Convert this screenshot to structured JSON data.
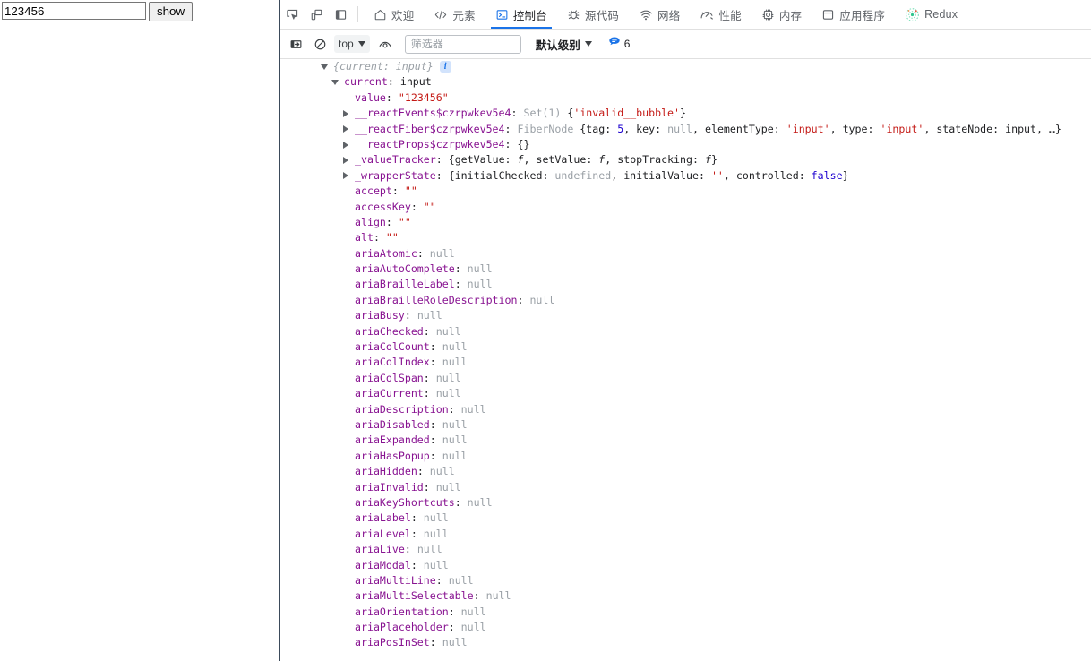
{
  "page": {
    "input_value": "123456",
    "input_placeholder": "",
    "show_button_label": "show"
  },
  "devtools": {
    "toolbar_icons": [
      {
        "name": "inspect-element-icon"
      },
      {
        "name": "device-toolbar-icon"
      },
      {
        "name": "dock-side-icon"
      }
    ],
    "tabs": [
      {
        "label": "欢迎",
        "icon": "home-icon",
        "active": false
      },
      {
        "label": "元素",
        "icon": "code-brackets-icon",
        "active": false
      },
      {
        "label": "控制台",
        "icon": "console-terminal-icon",
        "active": true
      },
      {
        "label": "源代码",
        "icon": "bug-sources-icon",
        "active": false
      },
      {
        "label": "网络",
        "icon": "wifi-network-icon",
        "active": false
      },
      {
        "label": "性能",
        "icon": "gauge-performance-icon",
        "active": false
      },
      {
        "label": "内存",
        "icon": "chip-memory-icon",
        "active": false
      },
      {
        "label": "应用程序",
        "icon": "application-panel-icon",
        "active": false
      },
      {
        "label": "Redux",
        "icon": "redux-atom-icon",
        "active": false
      }
    ],
    "filterbar": {
      "clear_console_icon": "clear-console-icon",
      "no_entry_icon": "no-entry-icon",
      "context_value": "top",
      "eye_icon": "live-expression-eye-icon",
      "filter_placeholder": "筛选器",
      "filter_value": "",
      "level_label": "默认级别",
      "message_icon": "message-bubble-icon",
      "message_count": "6"
    },
    "accent_color": "#1a73e8",
    "console_rows": [
      {
        "indent": 0,
        "arrow": "open",
        "parts": [
          {
            "t": "{current: input}",
            "c": "k-preview"
          },
          {
            "t": " ",
            "c": "punct"
          },
          {
            "t": "i",
            "c": "info-badge"
          }
        ]
      },
      {
        "indent": 1,
        "arrow": "open",
        "parts": [
          {
            "t": "current",
            "c": "k-prop"
          },
          {
            "t": ": ",
            "c": "punct"
          },
          {
            "t": "input",
            "c": "v-plain"
          }
        ]
      },
      {
        "indent": 2,
        "arrow": "none",
        "parts": [
          {
            "t": "value",
            "c": "k-prop"
          },
          {
            "t": ": ",
            "c": "punct"
          },
          {
            "t": "\"123456\"",
            "c": "v-str"
          }
        ]
      },
      {
        "indent": 2,
        "arrow": "closed",
        "parts": [
          {
            "t": "__reactEvents$czrpwkev5e4",
            "c": "k-prop"
          },
          {
            "t": ": ",
            "c": "punct"
          },
          {
            "t": "Set(1)",
            "c": "v-dim"
          },
          {
            "t": " {",
            "c": "punct"
          },
          {
            "t": "'invalid__bubble'",
            "c": "v-str"
          },
          {
            "t": "}",
            "c": "punct"
          }
        ]
      },
      {
        "indent": 2,
        "arrow": "closed",
        "parts": [
          {
            "t": "__reactFiber$czrpwkev5e4",
            "c": "k-prop"
          },
          {
            "t": ": ",
            "c": "punct"
          },
          {
            "t": "FiberNode",
            "c": "v-dim"
          },
          {
            "t": " {",
            "c": "punct"
          },
          {
            "t": "tag",
            "c": "v-plain"
          },
          {
            "t": ": ",
            "c": "punct"
          },
          {
            "t": "5",
            "c": "v-num"
          },
          {
            "t": ", ",
            "c": "punct"
          },
          {
            "t": "key",
            "c": "v-plain"
          },
          {
            "t": ": ",
            "c": "punct"
          },
          {
            "t": "null",
            "c": "v-null"
          },
          {
            "t": ", ",
            "c": "punct"
          },
          {
            "t": "elementType",
            "c": "v-plain"
          },
          {
            "t": ": ",
            "c": "punct"
          },
          {
            "t": "'input'",
            "c": "v-str"
          },
          {
            "t": ", ",
            "c": "punct"
          },
          {
            "t": "type",
            "c": "v-plain"
          },
          {
            "t": ": ",
            "c": "punct"
          },
          {
            "t": "'input'",
            "c": "v-str"
          },
          {
            "t": ", ",
            "c": "punct"
          },
          {
            "t": "stateNode",
            "c": "v-plain"
          },
          {
            "t": ": ",
            "c": "punct"
          },
          {
            "t": "input",
            "c": "v-plain"
          },
          {
            "t": ", …}",
            "c": "punct"
          }
        ]
      },
      {
        "indent": 2,
        "arrow": "closed",
        "parts": [
          {
            "t": "__reactProps$czrpwkev5e4",
            "c": "k-prop"
          },
          {
            "t": ": ",
            "c": "punct"
          },
          {
            "t": "{}",
            "c": "punct"
          }
        ]
      },
      {
        "indent": 2,
        "arrow": "closed",
        "parts": [
          {
            "t": "_valueTracker",
            "c": "k-prop"
          },
          {
            "t": ": ",
            "c": "punct"
          },
          {
            "t": "{",
            "c": "punct"
          },
          {
            "t": "getValue",
            "c": "v-plain"
          },
          {
            "t": ": ",
            "c": "punct"
          },
          {
            "t": "f",
            "c": "v-fn"
          },
          {
            "t": ", ",
            "c": "punct"
          },
          {
            "t": "setValue",
            "c": "v-plain"
          },
          {
            "t": ": ",
            "c": "punct"
          },
          {
            "t": "f",
            "c": "v-fn"
          },
          {
            "t": ", ",
            "c": "punct"
          },
          {
            "t": "stopTracking",
            "c": "v-plain"
          },
          {
            "t": ": ",
            "c": "punct"
          },
          {
            "t": "f",
            "c": "v-fn"
          },
          {
            "t": "}",
            "c": "punct"
          }
        ]
      },
      {
        "indent": 2,
        "arrow": "closed",
        "parts": [
          {
            "t": "_wrapperState",
            "c": "k-prop"
          },
          {
            "t": ": ",
            "c": "punct"
          },
          {
            "t": "{",
            "c": "punct"
          },
          {
            "t": "initialChecked",
            "c": "v-plain"
          },
          {
            "t": ": ",
            "c": "punct"
          },
          {
            "t": "undefined",
            "c": "v-undef"
          },
          {
            "t": ", ",
            "c": "punct"
          },
          {
            "t": "initialValue",
            "c": "v-plain"
          },
          {
            "t": ": ",
            "c": "punct"
          },
          {
            "t": "''",
            "c": "v-str"
          },
          {
            "t": ", ",
            "c": "punct"
          },
          {
            "t": "controlled",
            "c": "v-plain"
          },
          {
            "t": ": ",
            "c": "punct"
          },
          {
            "t": "false",
            "c": "v-bool"
          },
          {
            "t": "}",
            "c": "punct"
          }
        ]
      },
      {
        "indent": 2,
        "arrow": "none",
        "parts": [
          {
            "t": "accept",
            "c": "k-prop"
          },
          {
            "t": ": ",
            "c": "punct"
          },
          {
            "t": "\"\"",
            "c": "v-str"
          }
        ]
      },
      {
        "indent": 2,
        "arrow": "none",
        "parts": [
          {
            "t": "accessKey",
            "c": "k-prop"
          },
          {
            "t": ": ",
            "c": "punct"
          },
          {
            "t": "\"\"",
            "c": "v-str"
          }
        ]
      },
      {
        "indent": 2,
        "arrow": "none",
        "parts": [
          {
            "t": "align",
            "c": "k-prop"
          },
          {
            "t": ": ",
            "c": "punct"
          },
          {
            "t": "\"\"",
            "c": "v-str"
          }
        ]
      },
      {
        "indent": 2,
        "arrow": "none",
        "parts": [
          {
            "t": "alt",
            "c": "k-prop"
          },
          {
            "t": ": ",
            "c": "punct"
          },
          {
            "t": "\"\"",
            "c": "v-str"
          }
        ]
      },
      {
        "indent": 2,
        "arrow": "none",
        "parts": [
          {
            "t": "ariaAtomic",
            "c": "k-prop"
          },
          {
            "t": ": ",
            "c": "punct"
          },
          {
            "t": "null",
            "c": "v-null"
          }
        ]
      },
      {
        "indent": 2,
        "arrow": "none",
        "parts": [
          {
            "t": "ariaAutoComplete",
            "c": "k-prop"
          },
          {
            "t": ": ",
            "c": "punct"
          },
          {
            "t": "null",
            "c": "v-null"
          }
        ]
      },
      {
        "indent": 2,
        "arrow": "none",
        "parts": [
          {
            "t": "ariaBrailleLabel",
            "c": "k-prop"
          },
          {
            "t": ": ",
            "c": "punct"
          },
          {
            "t": "null",
            "c": "v-null"
          }
        ]
      },
      {
        "indent": 2,
        "arrow": "none",
        "parts": [
          {
            "t": "ariaBrailleRoleDescription",
            "c": "k-prop"
          },
          {
            "t": ": ",
            "c": "punct"
          },
          {
            "t": "null",
            "c": "v-null"
          }
        ]
      },
      {
        "indent": 2,
        "arrow": "none",
        "parts": [
          {
            "t": "ariaBusy",
            "c": "k-prop"
          },
          {
            "t": ": ",
            "c": "punct"
          },
          {
            "t": "null",
            "c": "v-null"
          }
        ]
      },
      {
        "indent": 2,
        "arrow": "none",
        "parts": [
          {
            "t": "ariaChecked",
            "c": "k-prop"
          },
          {
            "t": ": ",
            "c": "punct"
          },
          {
            "t": "null",
            "c": "v-null"
          }
        ]
      },
      {
        "indent": 2,
        "arrow": "none",
        "parts": [
          {
            "t": "ariaColCount",
            "c": "k-prop"
          },
          {
            "t": ": ",
            "c": "punct"
          },
          {
            "t": "null",
            "c": "v-null"
          }
        ]
      },
      {
        "indent": 2,
        "arrow": "none",
        "parts": [
          {
            "t": "ariaColIndex",
            "c": "k-prop"
          },
          {
            "t": ": ",
            "c": "punct"
          },
          {
            "t": "null",
            "c": "v-null"
          }
        ]
      },
      {
        "indent": 2,
        "arrow": "none",
        "parts": [
          {
            "t": "ariaColSpan",
            "c": "k-prop"
          },
          {
            "t": ": ",
            "c": "punct"
          },
          {
            "t": "null",
            "c": "v-null"
          }
        ]
      },
      {
        "indent": 2,
        "arrow": "none",
        "parts": [
          {
            "t": "ariaCurrent",
            "c": "k-prop"
          },
          {
            "t": ": ",
            "c": "punct"
          },
          {
            "t": "null",
            "c": "v-null"
          }
        ]
      },
      {
        "indent": 2,
        "arrow": "none",
        "parts": [
          {
            "t": "ariaDescription",
            "c": "k-prop"
          },
          {
            "t": ": ",
            "c": "punct"
          },
          {
            "t": "null",
            "c": "v-null"
          }
        ]
      },
      {
        "indent": 2,
        "arrow": "none",
        "parts": [
          {
            "t": "ariaDisabled",
            "c": "k-prop"
          },
          {
            "t": ": ",
            "c": "punct"
          },
          {
            "t": "null",
            "c": "v-null"
          }
        ]
      },
      {
        "indent": 2,
        "arrow": "none",
        "parts": [
          {
            "t": "ariaExpanded",
            "c": "k-prop"
          },
          {
            "t": ": ",
            "c": "punct"
          },
          {
            "t": "null",
            "c": "v-null"
          }
        ]
      },
      {
        "indent": 2,
        "arrow": "none",
        "parts": [
          {
            "t": "ariaHasPopup",
            "c": "k-prop"
          },
          {
            "t": ": ",
            "c": "punct"
          },
          {
            "t": "null",
            "c": "v-null"
          }
        ]
      },
      {
        "indent": 2,
        "arrow": "none",
        "parts": [
          {
            "t": "ariaHidden",
            "c": "k-prop"
          },
          {
            "t": ": ",
            "c": "punct"
          },
          {
            "t": "null",
            "c": "v-null"
          }
        ]
      },
      {
        "indent": 2,
        "arrow": "none",
        "parts": [
          {
            "t": "ariaInvalid",
            "c": "k-prop"
          },
          {
            "t": ": ",
            "c": "punct"
          },
          {
            "t": "null",
            "c": "v-null"
          }
        ]
      },
      {
        "indent": 2,
        "arrow": "none",
        "parts": [
          {
            "t": "ariaKeyShortcuts",
            "c": "k-prop"
          },
          {
            "t": ": ",
            "c": "punct"
          },
          {
            "t": "null",
            "c": "v-null"
          }
        ]
      },
      {
        "indent": 2,
        "arrow": "none",
        "parts": [
          {
            "t": "ariaLabel",
            "c": "k-prop"
          },
          {
            "t": ": ",
            "c": "punct"
          },
          {
            "t": "null",
            "c": "v-null"
          }
        ]
      },
      {
        "indent": 2,
        "arrow": "none",
        "parts": [
          {
            "t": "ariaLevel",
            "c": "k-prop"
          },
          {
            "t": ": ",
            "c": "punct"
          },
          {
            "t": "null",
            "c": "v-null"
          }
        ]
      },
      {
        "indent": 2,
        "arrow": "none",
        "parts": [
          {
            "t": "ariaLive",
            "c": "k-prop"
          },
          {
            "t": ": ",
            "c": "punct"
          },
          {
            "t": "null",
            "c": "v-null"
          }
        ]
      },
      {
        "indent": 2,
        "arrow": "none",
        "parts": [
          {
            "t": "ariaModal",
            "c": "k-prop"
          },
          {
            "t": ": ",
            "c": "punct"
          },
          {
            "t": "null",
            "c": "v-null"
          }
        ]
      },
      {
        "indent": 2,
        "arrow": "none",
        "parts": [
          {
            "t": "ariaMultiLine",
            "c": "k-prop"
          },
          {
            "t": ": ",
            "c": "punct"
          },
          {
            "t": "null",
            "c": "v-null"
          }
        ]
      },
      {
        "indent": 2,
        "arrow": "none",
        "parts": [
          {
            "t": "ariaMultiSelectable",
            "c": "k-prop"
          },
          {
            "t": ": ",
            "c": "punct"
          },
          {
            "t": "null",
            "c": "v-null"
          }
        ]
      },
      {
        "indent": 2,
        "arrow": "none",
        "parts": [
          {
            "t": "ariaOrientation",
            "c": "k-prop"
          },
          {
            "t": ": ",
            "c": "punct"
          },
          {
            "t": "null",
            "c": "v-null"
          }
        ]
      },
      {
        "indent": 2,
        "arrow": "none",
        "parts": [
          {
            "t": "ariaPlaceholder",
            "c": "k-prop"
          },
          {
            "t": ": ",
            "c": "punct"
          },
          {
            "t": "null",
            "c": "v-null"
          }
        ]
      },
      {
        "indent": 2,
        "arrow": "none",
        "parts": [
          {
            "t": "ariaPosInSet",
            "c": "k-prop"
          },
          {
            "t": ": ",
            "c": "punct"
          },
          {
            "t": "null",
            "c": "v-null"
          }
        ]
      }
    ]
  }
}
